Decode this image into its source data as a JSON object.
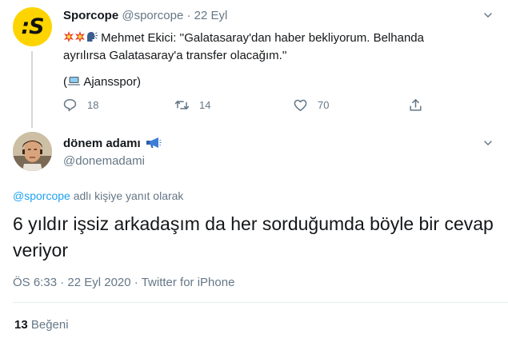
{
  "original_tweet": {
    "name": "Sporcope",
    "handle": "@sporcope",
    "separator": "·",
    "date": "22 Eyl",
    "avatar_text": ":S",
    "text_line1": "Mehmet Ekici: ''Galatasaray'dan haber bekliyorum. Belhanda",
    "text_line2": "ayrılırsa Galatasaray'a transfer olacağım.''",
    "source_open": "(",
    "source_name": "Ajansspor)",
    "emojis": [
      "collision-icon",
      "collision-icon",
      "speaking-head-icon"
    ],
    "reply_count": "18",
    "retweet_count": "14",
    "like_count": "70"
  },
  "reply_tweet": {
    "name": "dönem adamı",
    "handle": "@donemadami",
    "replying_to_handle": "@sporcope",
    "replying_to_suffix": "adlı kişiye yanıt olarak",
    "text": "6 yıldır işsiz arkadaşım da her sorduğumda böyle bir cevap veriyor",
    "time": "ÖS 6:33",
    "date": "22 Eyl 2020",
    "via": "Twitter for iPhone",
    "meta_separator": "·",
    "like_count": "13",
    "like_label": "Beğeni"
  },
  "colors": {
    "accent": "#1da1f2",
    "muted": "#657786",
    "brand_yellow": "#fdd400"
  }
}
